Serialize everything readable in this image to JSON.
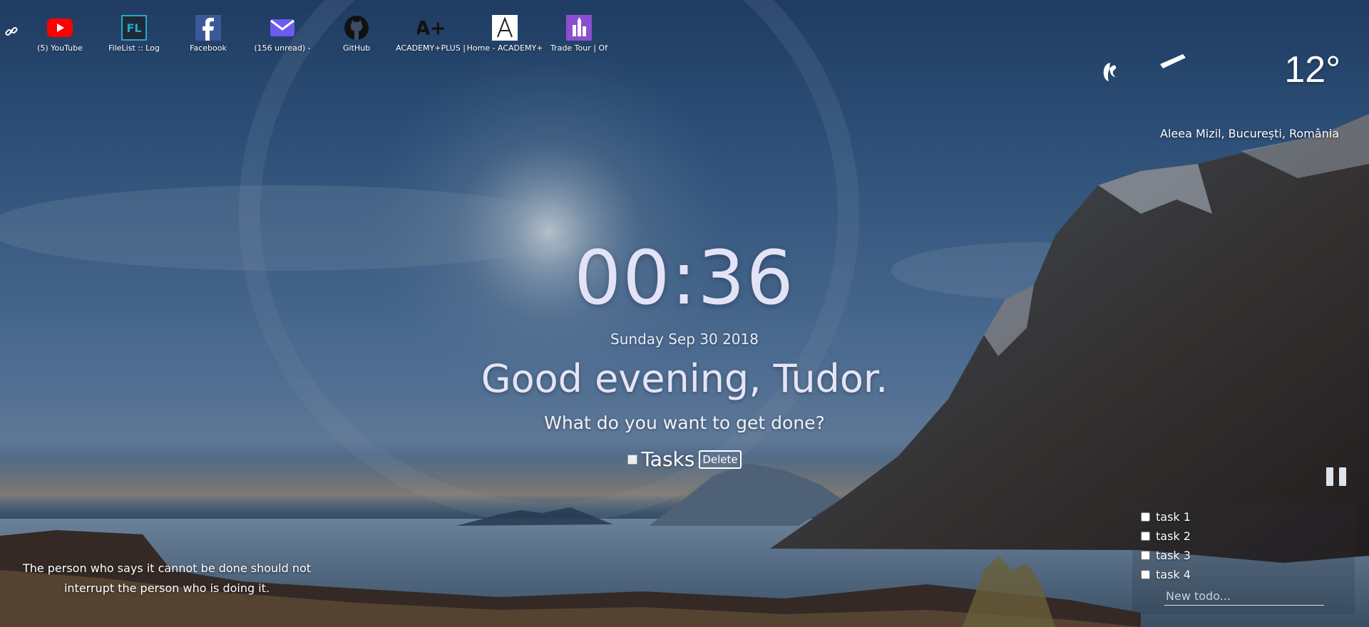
{
  "bookmarks": [
    {
      "label": "(5) YouTube",
      "icon": "youtube-icon"
    },
    {
      "label": "FileList :: Log",
      "icon": "filelist-icon"
    },
    {
      "label": "Facebook",
      "icon": "facebook-icon"
    },
    {
      "label": "(156 unread) -",
      "icon": "mail-icon"
    },
    {
      "label": "GitHub",
      "icon": "github-icon"
    },
    {
      "label": "ACADEMY+PLUS |",
      "icon": "academy-plus-icon"
    },
    {
      "label": "Home - ACADEMY+",
      "icon": "academy-home-icon"
    },
    {
      "label": "Trade Tour | Of",
      "icon": "trade-tour-icon"
    }
  ],
  "weather": {
    "temperature": "12°",
    "location": "Aleea Mizil, București, România"
  },
  "clock": {
    "time": "00:36",
    "date": "Sunday Sep 30 2018"
  },
  "greeting": "Good evening, Tudor.",
  "focus": {
    "question": "What do you want to get done?",
    "task": "Tasks",
    "delete_label": "Delete"
  },
  "quote": "The person who says it cannot be done should not interrupt the person who is doing it.",
  "todo": {
    "items": [
      "task 1",
      "task 2",
      "task 3",
      "task 4"
    ],
    "placeholder": "New todo..."
  }
}
